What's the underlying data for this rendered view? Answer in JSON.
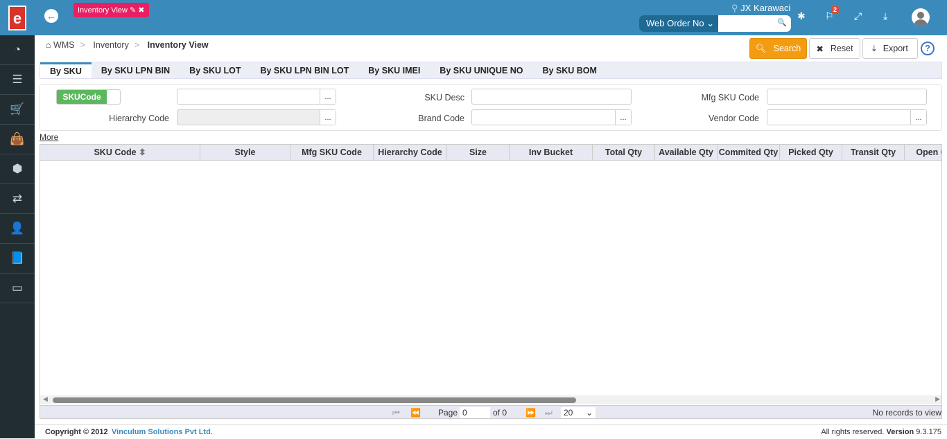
{
  "app": {
    "logo_letter": "e",
    "open_tab": "Inventory View",
    "location": "JX Karawaci",
    "search_type": "Web Order No",
    "notification_count": "2"
  },
  "sidebar": {
    "items": [
      {
        "icon": "dashboard-icon",
        "glyph": "◔"
      },
      {
        "icon": "list-icon",
        "glyph": "☰"
      },
      {
        "icon": "cart-icon",
        "glyph": "🛒"
      },
      {
        "icon": "shopping-bag-icon",
        "glyph": "👜"
      },
      {
        "icon": "cubes-icon",
        "glyph": "⬢"
      },
      {
        "icon": "exchange-icon",
        "glyph": "⇄"
      },
      {
        "icon": "user-plus-icon",
        "glyph": "👤"
      },
      {
        "icon": "book-icon",
        "glyph": "📘"
      },
      {
        "icon": "credit-card-icon",
        "glyph": "▭"
      }
    ]
  },
  "breadcrumb": [
    "WMS",
    "Inventory",
    "Inventory View"
  ],
  "toolbar": {
    "search": "Search",
    "reset": "Reset",
    "export": "Export",
    "help": "?"
  },
  "tabs": [
    "By SKU",
    "By SKU LPN BIN",
    "By SKU LOT",
    "By SKU LPN BIN LOT",
    "By SKU IMEI",
    "By SKU UNIQUE NO",
    "By SKU BOM"
  ],
  "filters": {
    "toggle": "SKUCode",
    "hierarchy": "Hierarchy Code",
    "sku_desc": "SKU Desc",
    "brand": "Brand Code",
    "mfg": "Mfg SKU Code",
    "vendor": "Vendor Code",
    "dots": "...",
    "more": "More"
  },
  "grid": {
    "columns": [
      "SKU Code",
      "Style",
      "Mfg SKU Code",
      "Hierarchy Code",
      "Size",
      "Inv Bucket",
      "Total Qty",
      "Available Qty",
      "Commited Qty",
      "Picked Qty",
      "Transit Qty",
      "Open Qty"
    ]
  },
  "pager": {
    "page_label": "Page",
    "page": "0",
    "of": "of 0",
    "page_size": "20",
    "status": "No records to view"
  },
  "footer": {
    "copyright": "Copyright © 2012",
    "company": "Vinculum Solutions Pvt Ltd.",
    "rights": "All rights reserved.",
    "version_label": "Version",
    "version": "9.3.175"
  }
}
